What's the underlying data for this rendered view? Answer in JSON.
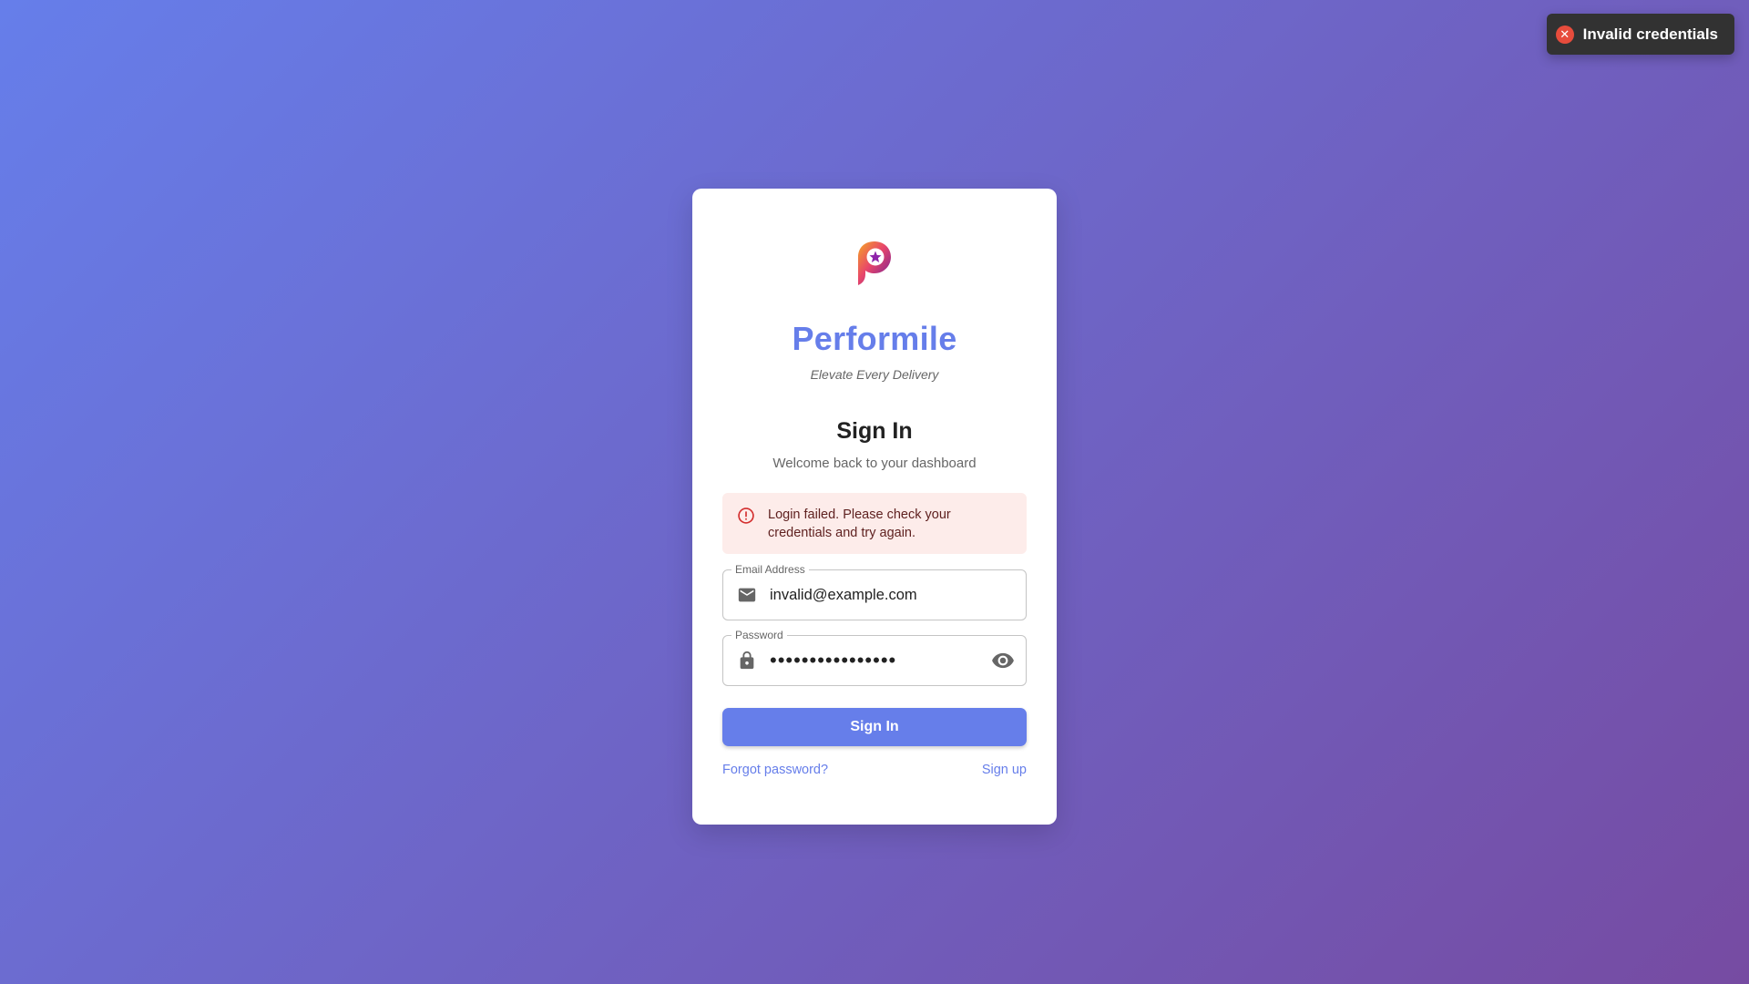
{
  "toast": {
    "message": "Invalid credentials",
    "icon": "error-circle-icon",
    "color": "#e74c3c"
  },
  "brand": {
    "name": "Performile",
    "tagline": "Elevate Every Delivery",
    "color": "#667eea"
  },
  "form": {
    "heading": "Sign In",
    "subheading": "Welcome back to your dashboard",
    "error": "Login failed. Please check your credentials and try again.",
    "email": {
      "label": "Email Address",
      "value": "invalid@example.com",
      "icon": "email-icon"
    },
    "password": {
      "label": "Password",
      "value": "••••••••••••••••",
      "icon": "lock-icon",
      "toggle_icon": "eye-icon"
    },
    "submit_label": "Sign In",
    "forgot_label": "Forgot password?",
    "signup_label": "Sign up"
  }
}
